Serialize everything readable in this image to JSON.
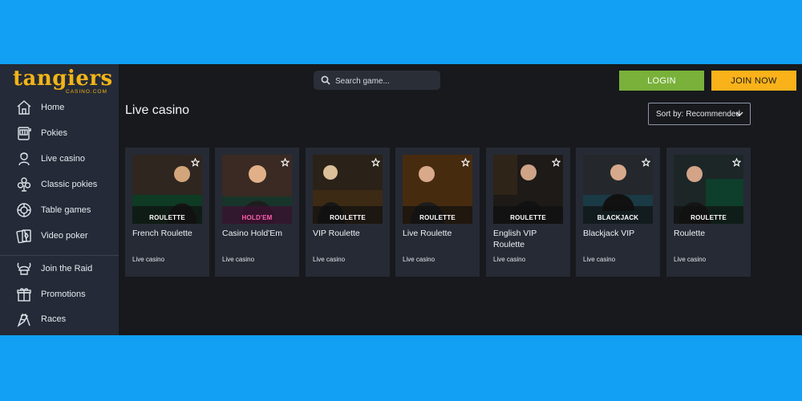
{
  "brand": {
    "name": "tangiers",
    "sub": "CASINO.COM",
    "color": "#f3b417"
  },
  "sidebar": {
    "items": [
      {
        "label": "Home",
        "icon": "home-icon"
      },
      {
        "label": "Pokies",
        "icon": "slot-machine-icon"
      },
      {
        "label": "Live casino",
        "icon": "live-dealer-icon"
      },
      {
        "label": "Classic pokies",
        "icon": "cards-icon"
      },
      {
        "label": "Table games",
        "icon": "poker-chip-icon"
      },
      {
        "label": "Video poker",
        "icon": "video-poker-icon"
      }
    ],
    "items2": [
      {
        "label": "Join the Raid",
        "icon": "viking-helmet-icon"
      },
      {
        "label": "Promotions",
        "icon": "gift-icon"
      },
      {
        "label": "Races",
        "icon": "checkered-flags-icon"
      }
    ]
  },
  "header": {
    "search_placeholder": "Search game...",
    "login_label": "LOGIN",
    "join_label": "JOIN NOW",
    "login_color": "#79b13a",
    "join_color": "#f9b21a"
  },
  "main": {
    "title": "Live casino",
    "sort_label": "Sort by: Recommended",
    "games": [
      {
        "title": "French Roulette",
        "category": "Live casino",
        "badge": "ROULETTE"
      },
      {
        "title": "Casino Hold'Em",
        "category": "Live casino",
        "badge": "HOLD'EM"
      },
      {
        "title": "VIP Roulette",
        "category": "Live casino",
        "badge": "ROULETTE"
      },
      {
        "title": "Live Roulette",
        "category": "Live casino",
        "badge": "ROULETTE"
      },
      {
        "title": "English VIP Roulette",
        "category": "Live casino",
        "badge": "ROULETTE"
      },
      {
        "title": "Blackjack VIP",
        "category": "Live casino",
        "badge": "BLACKJACK"
      },
      {
        "title": "Roulette",
        "category": "Live casino",
        "badge": "ROULETTE"
      }
    ]
  }
}
